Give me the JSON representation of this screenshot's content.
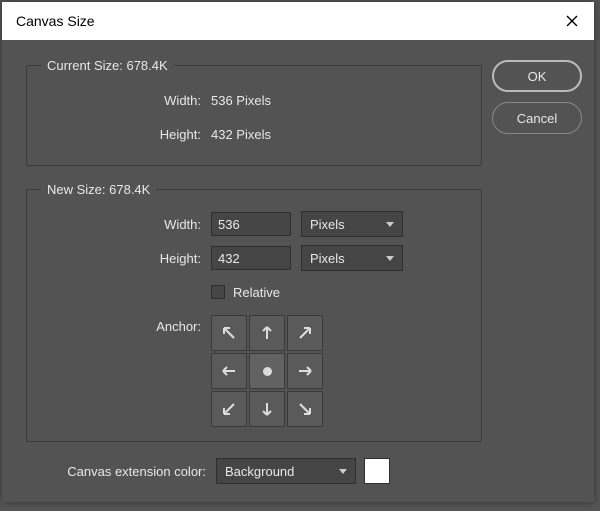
{
  "title": "Canvas Size",
  "buttons": {
    "ok": "OK",
    "cancel": "Cancel"
  },
  "current": {
    "legend": "Current Size: 678.4K",
    "width_label": "Width:",
    "width_value": "536 Pixels",
    "height_label": "Height:",
    "height_value": "432 Pixels"
  },
  "new": {
    "legend": "New Size: 678.4K",
    "width_label": "Width:",
    "width_value": "536",
    "width_unit": "Pixels",
    "height_label": "Height:",
    "height_value": "432",
    "height_unit": "Pixels",
    "relative_label": "Relative",
    "anchor_label": "Anchor:"
  },
  "extension": {
    "label": "Canvas extension color:",
    "value": "Background",
    "swatch": "#ffffff"
  }
}
